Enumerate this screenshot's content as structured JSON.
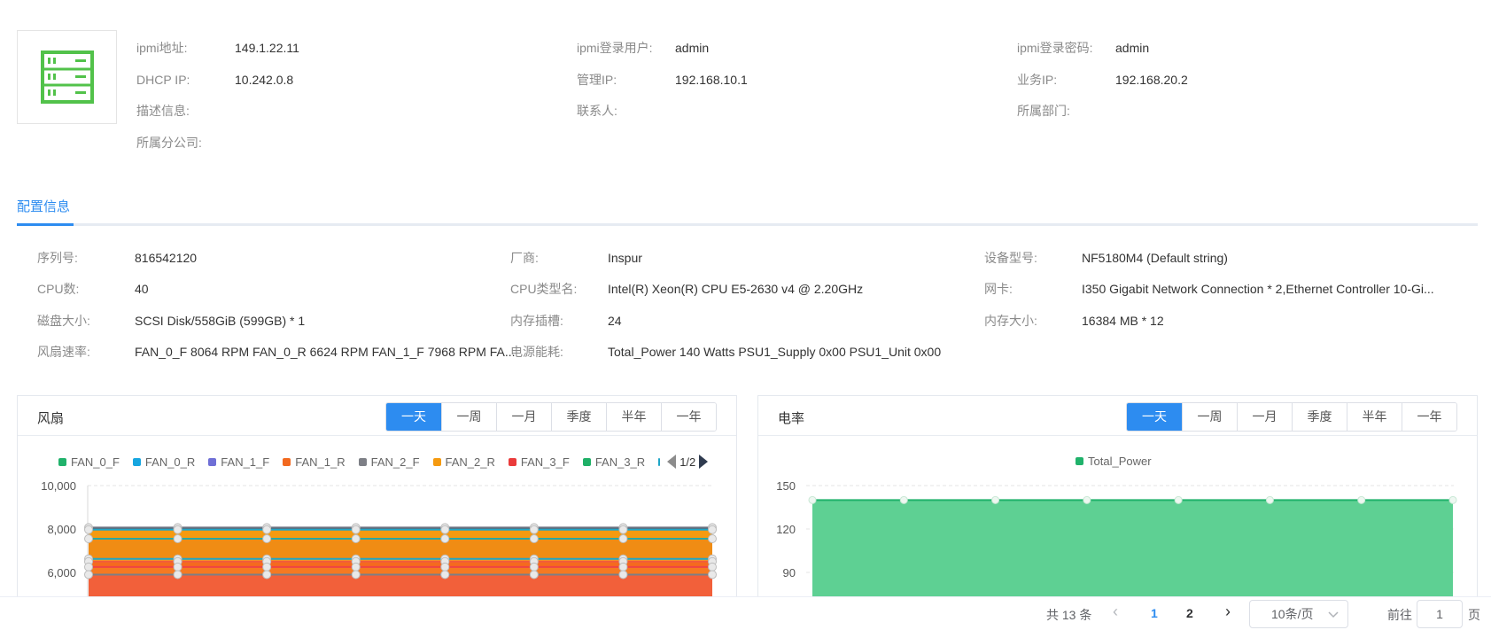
{
  "device_info": {
    "ipmi_addr_label": "ipmi地址:",
    "ipmi_addr": "149.1.22.11",
    "ipmi_user_label": "ipmi登录用户:",
    "ipmi_user": "admin",
    "ipmi_pass_label": "ipmi登录密码:",
    "ipmi_pass": "admin",
    "dhcp_label": "DHCP IP:",
    "dhcp_ip": "10.242.0.8",
    "mgmt_label": "管理IP:",
    "mgmt_ip": "192.168.10.1",
    "biz_label": "业务IP:",
    "biz_ip": "192.168.20.2",
    "desc_label": "描述信息:",
    "contact_label": "联系人:",
    "dept_label": "所属部门:",
    "branch_label": "所属分公司:"
  },
  "tabs": {
    "config": "配置信息"
  },
  "config": {
    "serial_label": "序列号:",
    "serial": "816542120",
    "vendor_label": "厂商:",
    "vendor": "Inspur",
    "model_label": "设备型号:",
    "model": "NF5180M4 (Default string)",
    "cpu_count_label": "CPU数:",
    "cpu_count": "40",
    "cpu_type_label": "CPU类型名:",
    "cpu_type": "Intel(R) Xeon(R) CPU E5-2630 v4 @ 2.20GHz",
    "nic_label": "网卡:",
    "nic": "I350 Gigabit Network Connection * 2,Ethernet Controller 10-Gi...",
    "disk_label": "磁盘大小:",
    "disk": "SCSI Disk/558GiB (599GB) * 1",
    "mem_slot_label": "内存插槽:",
    "mem_slot": "24",
    "mem_size_label": "内存大小:",
    "mem_size": "16384 MB * 12",
    "fan_label": "风扇速率:",
    "fan": "FAN_0_F 8064 RPM FAN_0_R 6624 RPM FAN_1_F 7968 RPM FA...",
    "power_label": "电源能耗:",
    "power": "Total_Power 140 Watts PSU1_Supply 0x00 PSU1_Unit 0x00"
  },
  "range_buttons": [
    "一天",
    "一周",
    "一月",
    "季度",
    "半年",
    "一年"
  ],
  "fan_panel": {
    "title": "风扇",
    "legend_page": "1/2"
  },
  "power_panel": {
    "title": "电率"
  },
  "chart_data": [
    {
      "type": "area",
      "series": [
        {
          "name": "FAN_0_F",
          "color": "#20b26b"
        },
        {
          "name": "FAN_0_R",
          "color": "#17a6e0"
        },
        {
          "name": "FAN_1_F",
          "color": "#6f6fd6"
        },
        {
          "name": "FAN_1_R",
          "color": "#f2691f"
        },
        {
          "name": "FAN_2_F",
          "color": "#7d7f86"
        },
        {
          "name": "FAN_2_R",
          "color": "#f59a10"
        },
        {
          "name": "FAN_3_F",
          "color": "#ea3b3b"
        },
        {
          "name": "FAN_3_R",
          "color": "#1fb067"
        }
      ],
      "yticks": [
        "10,000",
        "8,000",
        "6,000"
      ],
      "ylim": [
        5000,
        10000
      ],
      "line_values": [
        8064,
        7968,
        7550,
        6624,
        6500,
        6250,
        5900
      ],
      "point_count": 8,
      "legend_position": "top"
    },
    {
      "type": "area",
      "series": [
        {
          "name": "Total_Power",
          "values": [
            140,
            140,
            140,
            140,
            140,
            140,
            140,
            140
          ],
          "color": "#5ed093"
        }
      ],
      "yticks": [
        "150",
        "120",
        "90"
      ],
      "ylim": [
        80,
        150
      ],
      "legend_position": "top"
    }
  ],
  "pagination": {
    "total": "共 13 条",
    "prev": "‹",
    "pages": [
      "1",
      "2"
    ],
    "next": "›",
    "page_size": "10条/页",
    "goto_label": "前往",
    "goto_value": "1",
    "page_unit": "页"
  }
}
